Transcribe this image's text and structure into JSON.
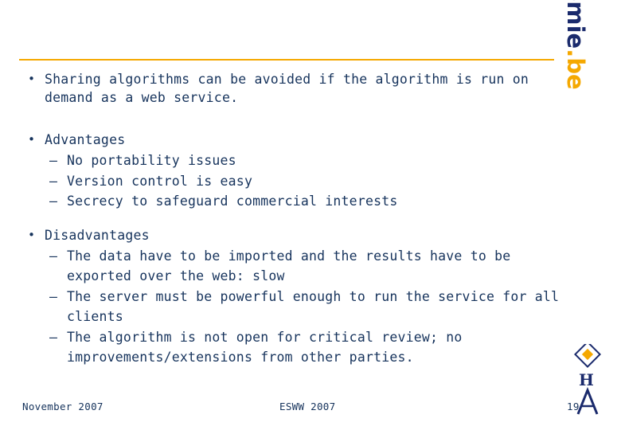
{
  "slide": {
    "brand": {
      "name": "aeronomie",
      "tld": ".be"
    },
    "bullets": [
      {
        "level": 1,
        "marker": "•",
        "text": "Sharing algorithms can be avoided if the algorithm is run on demand as a web service."
      },
      {
        "level": 1,
        "marker": "•",
        "text": "Advantages"
      },
      {
        "level": 2,
        "marker": "–",
        "text": "No portability issues"
      },
      {
        "level": 2,
        "marker": "–",
        "text": "Version control is easy"
      },
      {
        "level": 2,
        "marker": "–",
        "text": "Secrecy to safeguard commercial interests"
      },
      {
        "level": 1,
        "marker": "•",
        "text": "Disadvantages"
      },
      {
        "level": 2,
        "marker": "–",
        "text": "The data have to be imported and the results have to be exported over the web: slow"
      },
      {
        "level": 2,
        "marker": "–",
        "text": "The server must be powerful enough to run the service for all clients"
      },
      {
        "level": 2,
        "marker": "–",
        "text": "The algorithm is not open for critical review; no improvements/extensions from other parties."
      }
    ],
    "footer": {
      "left": "November 2007",
      "center": "ESWW 2007",
      "right": "19"
    },
    "colors": {
      "text": "#16335c",
      "accent_rule": "#f5a800",
      "brand_navy": "#1a2a6c",
      "brand_gold": "#f5a800"
    }
  }
}
